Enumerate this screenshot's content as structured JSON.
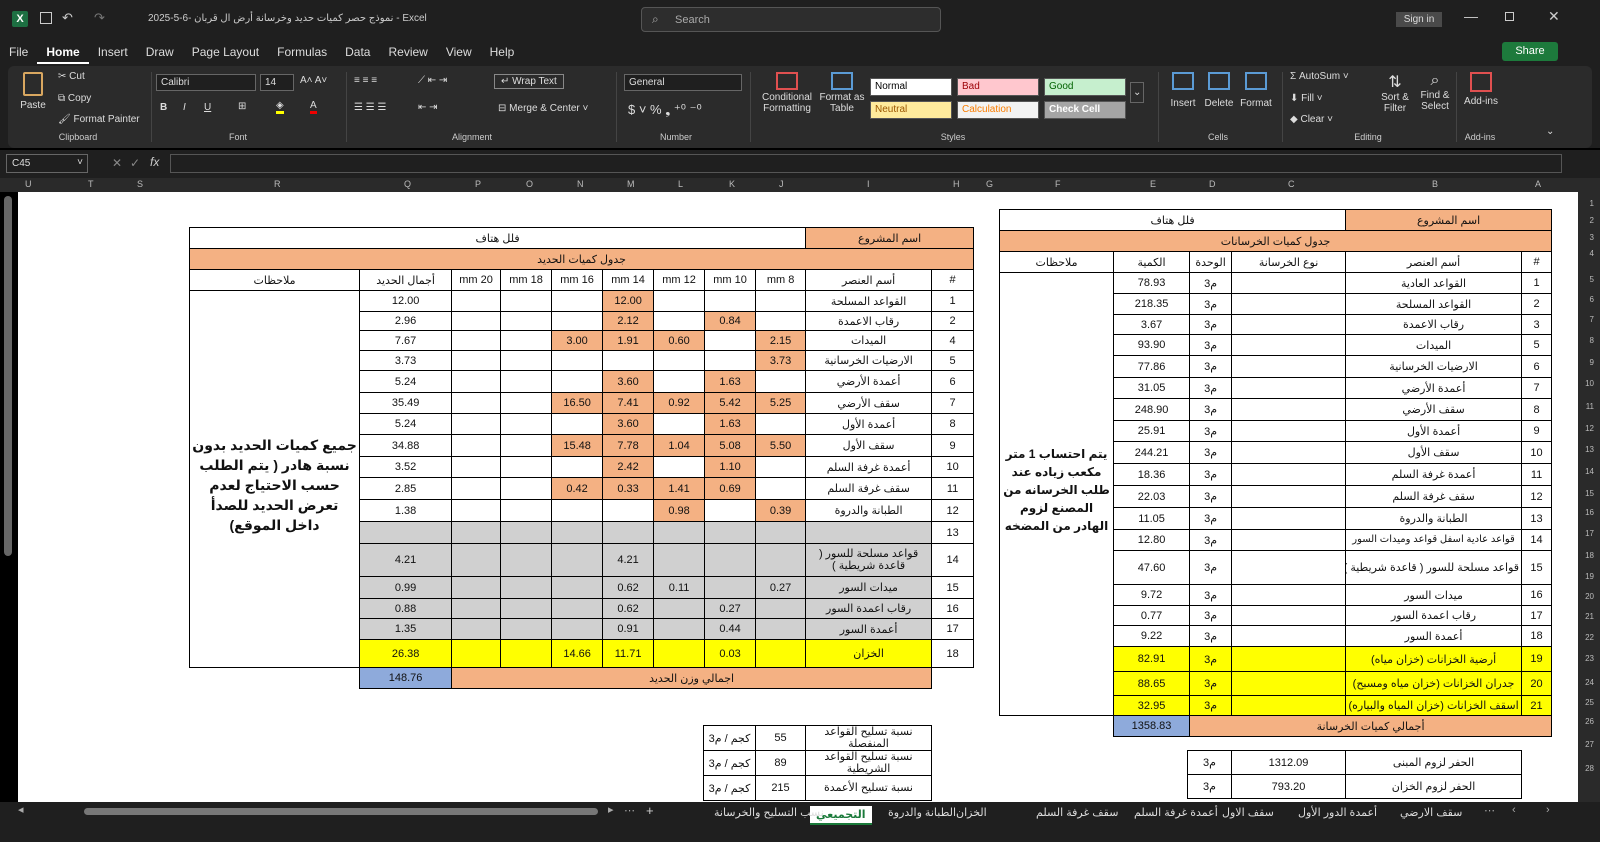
{
  "window": {
    "title": "نموذج حصر كميات حديد وخرسانة أرض ال قربان -6-5-2025 - Excel",
    "search_placeholder": "Search",
    "sign_in": "Sign in"
  },
  "tabs": [
    "File",
    "Home",
    "Insert",
    "Draw",
    "Page Layout",
    "Formulas",
    "Data",
    "Review",
    "View",
    "Help"
  ],
  "share": "Share",
  "ribbon": {
    "paste": "Paste",
    "cut": "Cut",
    "copy": "Copy",
    "format_painter": "Format Painter",
    "clipboard": "Clipboard",
    "font_name": "Calibri",
    "font_size": "14",
    "font": "Font",
    "wrap_text": "Wrap Text",
    "merge_center": "Merge & Center",
    "alignment": "Alignment",
    "number_format": "General",
    "number": "Number",
    "conditional": "Conditional Formatting",
    "format_table": "Format as Table",
    "styles": "Styles",
    "normal": "Normal",
    "bad": "Bad",
    "good": "Good",
    "neutral": "Neutral",
    "calculation": "Calculation",
    "check_cell": "Check Cell",
    "insert": "Insert",
    "delete": "Delete",
    "format": "Format",
    "cells": "Cells",
    "autosum": "AutoSum",
    "fill": "Fill",
    "clear": "Clear",
    "sort_filter": "Sort & Filter",
    "find_select": "Find & Select",
    "editing": "Editing",
    "addins": "Add-ins",
    "addins_group": "Add-ins"
  },
  "namebox": "C45",
  "columns": [
    "U",
    "T",
    "S",
    "R",
    "Q",
    "P",
    "O",
    "N",
    "M",
    "L",
    "K",
    "J",
    "I",
    "H",
    "G",
    "F",
    "E",
    "D",
    "C",
    "B",
    "A"
  ],
  "rows": [
    "1",
    "2",
    "3",
    "4",
    "5",
    "6",
    "7",
    "8",
    "9",
    "10",
    "11",
    "12",
    "13",
    "14",
    "15",
    "16",
    "17",
    "18",
    "19",
    "20",
    "21",
    "22",
    "23",
    "24",
    "25",
    "26",
    "27",
    "28"
  ],
  "steel": {
    "project_label": "اسم المشروع",
    "project_name": "فلل هتاف",
    "table_title": "جدول كميات الحديد",
    "headers": [
      "#",
      "أسم العنصر",
      "8 mm",
      "10 mm",
      "12 mm",
      "14 mm",
      "16 mm",
      "18 mm",
      "20 mm",
      "أجمال الحديد",
      "ملاحظات"
    ],
    "rows": [
      [
        "1",
        "القواعد المسلحة",
        "",
        "",
        "",
        "12.00",
        "",
        "",
        "",
        "12.00"
      ],
      [
        "2",
        "رقاب الاعمدة",
        "",
        "0.84",
        "",
        "2.12",
        "",
        "",
        "",
        "2.96"
      ],
      [
        "4",
        "الميدات",
        "2.15",
        "",
        "0.60",
        "1.91",
        "3.00",
        "",
        "",
        "7.67"
      ],
      [
        "5",
        "الارضيات الخرسانية",
        "3.73",
        "",
        "",
        "",
        "",
        "",
        "",
        "3.73"
      ],
      [
        "6",
        "أعمدة الأرضي",
        "",
        "1.63",
        "",
        "3.60",
        "",
        "",
        "",
        "5.24"
      ],
      [
        "7",
        "سقف الأرضي",
        "5.25",
        "5.42",
        "0.92",
        "7.41",
        "16.50",
        "",
        "",
        "35.49"
      ],
      [
        "8",
        "أعمدة الأول",
        "",
        "1.63",
        "",
        "3.60",
        "",
        "",
        "",
        "5.24"
      ],
      [
        "9",
        "سقف الأول",
        "5.50",
        "5.08",
        "1.04",
        "7.78",
        "15.48",
        "",
        "",
        "34.88"
      ],
      [
        "10",
        "أعمدة غرفة السلم",
        "",
        "1.10",
        "",
        "2.42",
        "",
        "",
        "",
        "3.52"
      ],
      [
        "11",
        "سقف غرفة السلم",
        "",
        "0.69",
        "1.41",
        "0.33",
        "0.42",
        "",
        "",
        "2.85"
      ],
      [
        "12",
        "الطبانة والدروة",
        "0.39",
        "",
        "0.98",
        "",
        "",
        "",
        "",
        "1.38"
      ],
      [
        "13",
        "",
        "",
        "",
        "",
        "",
        "",
        "",
        "",
        ""
      ],
      [
        "14",
        "قواعد مسلحة للسور ( قاعدة شريطية )",
        "",
        "",
        "",
        "4.21",
        "",
        "",
        "",
        "4.21"
      ],
      [
        "15",
        "ميدات السور",
        "0.27",
        "",
        "0.11",
        "0.62",
        "",
        "",
        "",
        "0.99"
      ],
      [
        "16",
        "رقاب اعمدة السور",
        "",
        "0.27",
        "",
        "0.62",
        "",
        "",
        "",
        "0.88"
      ],
      [
        "17",
        "أعمدة السور",
        "",
        "0.44",
        "",
        "0.91",
        "",
        "",
        "",
        "1.35"
      ],
      [
        "18",
        "الخزان",
        "",
        "0.03",
        "",
        "11.71",
        "14.66",
        "",
        "",
        "26.38"
      ]
    ],
    "note": "جميع كميات الحديد بدون نسبة هادر ( يتم الطلب حسب الاحتياج لعدم تعرض الحديد للصدأ داخل الموقع)",
    "total_label": "اجمالي وزن الحديد",
    "total_value": "148.76"
  },
  "concrete": {
    "project_label": "اسم المشروع",
    "project_name": "فلل هتاف",
    "table_title": "جدول كميات الخرسانات",
    "headers": [
      "#",
      "أسم العنصر",
      "نوع الخرسانة",
      "الوحدة",
      "الكمية",
      "ملاحظات"
    ],
    "rows": [
      [
        "1",
        "القواعد العادية",
        "",
        "م3",
        "78.93"
      ],
      [
        "2",
        "القواعد المسلحة",
        "",
        "م3",
        "218.35"
      ],
      [
        "3",
        "رقاب الاعمدة",
        "",
        "م3",
        "3.67"
      ],
      [
        "5",
        "الميدات",
        "",
        "م3",
        "93.90"
      ],
      [
        "6",
        "الارضيات الخرسانية",
        "",
        "م3",
        "77.86"
      ],
      [
        "7",
        "أعمدة الأرضي",
        "",
        "م3",
        "31.05"
      ],
      [
        "8",
        "سقف الأرضي",
        "",
        "م3",
        "248.90"
      ],
      [
        "9",
        "أعمدة الأول",
        "",
        "م3",
        "25.91"
      ],
      [
        "10",
        "سقف الأول",
        "",
        "م3",
        "244.21"
      ],
      [
        "11",
        "أعمدة غرفة السلم",
        "",
        "م3",
        "18.36"
      ],
      [
        "12",
        "سقف غرفة السلم",
        "",
        "م3",
        "22.03"
      ],
      [
        "13",
        "الطبانة والدروة",
        "",
        "م3",
        "11.05"
      ],
      [
        "14",
        "قواعد عادية اسفل قواعد وميدات السور",
        "",
        "م3",
        "12.80"
      ],
      [
        "15",
        "قواعد مسلحة للسور ( قاعدة شريطية )",
        "",
        "م3",
        "47.60"
      ],
      [
        "16",
        "ميدات السور",
        "",
        "م3",
        "9.72"
      ],
      [
        "17",
        "رقاب اعمدة السور",
        "",
        "م3",
        "0.77"
      ],
      [
        "18",
        "أعمدة السور",
        "",
        "م3",
        "9.22"
      ],
      [
        "19",
        "أرضية الخزانات (خزان مياه)",
        "",
        "م3",
        "82.91"
      ],
      [
        "20",
        "جدران الخزانات (خزان مياه ومسبح)",
        "",
        "م3",
        "88.65"
      ],
      [
        "21",
        "اسقف الخزانات (خزان المياه والبياره)",
        "",
        "م3",
        "32.95"
      ]
    ],
    "note": "يتم احتساب 1 متر مكعب زياده عند طلب الخرسانه من المصنع لزوم الهادر من المضخه",
    "total_label": "أجمالي كميات الخرسانة",
    "total_value": "1358.83"
  },
  "ratios": [
    {
      "label": "نسبة تسليح القواعد المنفصلة",
      "value": "55",
      "unit": "كجم / م3"
    },
    {
      "label": "نسبة تسليح القواعد الشريطية",
      "value": "89",
      "unit": "كجم / م3"
    },
    {
      "label": "نسبة تسليح الأعمدة",
      "value": "215",
      "unit": "كجم / م3"
    }
  ],
  "excavation": [
    {
      "label": "الحفر لزوم المبنى",
      "value": "1312.09",
      "unit": "م3"
    },
    {
      "label": "الحفر لزوم الخزان",
      "value": "793.20",
      "unit": "م3"
    }
  ],
  "sheets": [
    "سقف الارضي",
    "أعمدة الدور الأول",
    "سقف الاول",
    "أعمدة غرفة السلم",
    "سقف غرفة السلم",
    "الخزان",
    "الطبانة والدروة",
    "التجميعي",
    "نسب التسليح والخرسانة"
  ],
  "active_sheet": "التجميعي"
}
